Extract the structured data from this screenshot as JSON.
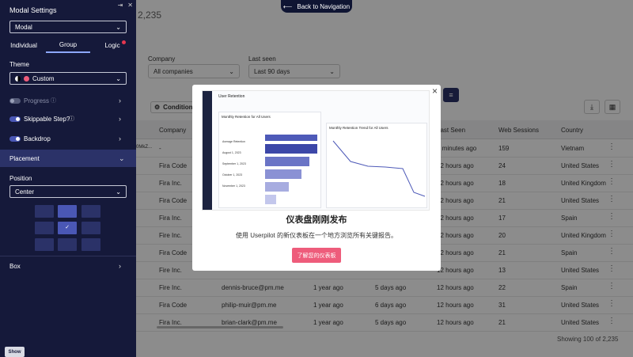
{
  "page": {
    "count_text": "2,235",
    "back_label": "Back to Navigation",
    "filters": [
      {
        "label": "Company",
        "value": "All companies"
      },
      {
        "label": "Last seen",
        "value": "Last 90 days"
      }
    ],
    "conditions_label": "Conditions",
    "table": {
      "headers": [
        "Company",
        "Last Seen",
        "Web Sessions",
        "Country"
      ],
      "rows": [
        {
          "user": "0MkZ...",
          "company": "-",
          "email": "",
          "first": "",
          "last_active": "",
          "last_seen": "5 minutes ago",
          "sessions": "159",
          "country": "Vietnam"
        },
        {
          "user": "",
          "company": "Fira Code",
          "email": "",
          "first": "",
          "last_active": "",
          "last_seen": "12 hours ago",
          "sessions": "24",
          "country": "United States"
        },
        {
          "user": "",
          "company": "Fira Inc.",
          "email": "",
          "first": "",
          "last_active": "",
          "last_seen": "12 hours ago",
          "sessions": "18",
          "country": "United Kingdom"
        },
        {
          "user": "",
          "company": "Fira Code",
          "email": "",
          "first": "",
          "last_active": "",
          "last_seen": "12 hours ago",
          "sessions": "21",
          "country": "United States"
        },
        {
          "user": "",
          "company": "Fira Inc.",
          "email": "",
          "first": "",
          "last_active": "",
          "last_seen": "12 hours ago",
          "sessions": "17",
          "country": "Spain"
        },
        {
          "user": "",
          "company": "Fire Inc.",
          "email": "",
          "first": "",
          "last_active": "",
          "last_seen": "12 hours ago",
          "sessions": "20",
          "country": "United Kingdom"
        },
        {
          "user": "",
          "company": "Fira Code",
          "email": "",
          "first": "",
          "last_active": "",
          "last_seen": "12 hours ago",
          "sessions": "21",
          "country": "Spain"
        },
        {
          "user": "",
          "company": "Fire Inc.",
          "email": "",
          "first": "",
          "last_active": "",
          "last_seen": "12 hours ago",
          "sessions": "13",
          "country": "United States"
        },
        {
          "user": "",
          "company": "Fire Inc.",
          "email": "dennis-bruce@pm.me",
          "first": "1 year ago",
          "last_active": "5 days ago",
          "last_seen": "12 hours ago",
          "sessions": "22",
          "country": "Spain"
        },
        {
          "user": "",
          "company": "Fira Code",
          "email": "philip-muir@pm.me",
          "first": "1 year ago",
          "last_active": "6 days ago",
          "last_seen": "12 hours ago",
          "sessions": "31",
          "country": "United States"
        },
        {
          "user": "",
          "company": "Fira Inc.",
          "email": "brian-clark@pm.me",
          "first": "1 year ago",
          "last_active": "5 days ago",
          "last_seen": "12 hours ago",
          "sessions": "21",
          "country": "United States"
        }
      ]
    },
    "footer_text": "Showing 100 of 2,235"
  },
  "modal": {
    "title": "仪表盘刚刚发布",
    "description": "使用 Userpilot 的新仪表板在一个地方浏览所有关键报告。",
    "cta_label": "了解您的仪表板",
    "close_label": "×",
    "preview": {
      "app_title": "User Retention",
      "card_left": "Monthly Retention for All Users",
      "card_right": "Monthly Retention Trend for All Users",
      "row_labels": [
        "Average Retention",
        "August 1, 2023",
        "September 1, 2023",
        "October 1, 2023",
        "November 1, 2023"
      ]
    }
  },
  "panel": {
    "title": "Modal Settings",
    "type_value": "Modal",
    "tabs": [
      "Individual",
      "Group",
      "Logic"
    ],
    "active_tab": "Group",
    "theme_label": "Theme",
    "theme_value": "Custom",
    "progress_label": "Progress",
    "skippable_label": "Skippable Step?",
    "backdrop_label": "Backdrop",
    "placement_label": "Placement",
    "position_label": "Position",
    "position_value": "Center",
    "box_label": "Box",
    "show_label": "Show",
    "colors": {
      "accent": "#4a57b5",
      "panel_bg": "#15193a",
      "cta": "#ee5c7b",
      "logic_dot": "#e5364f"
    }
  }
}
